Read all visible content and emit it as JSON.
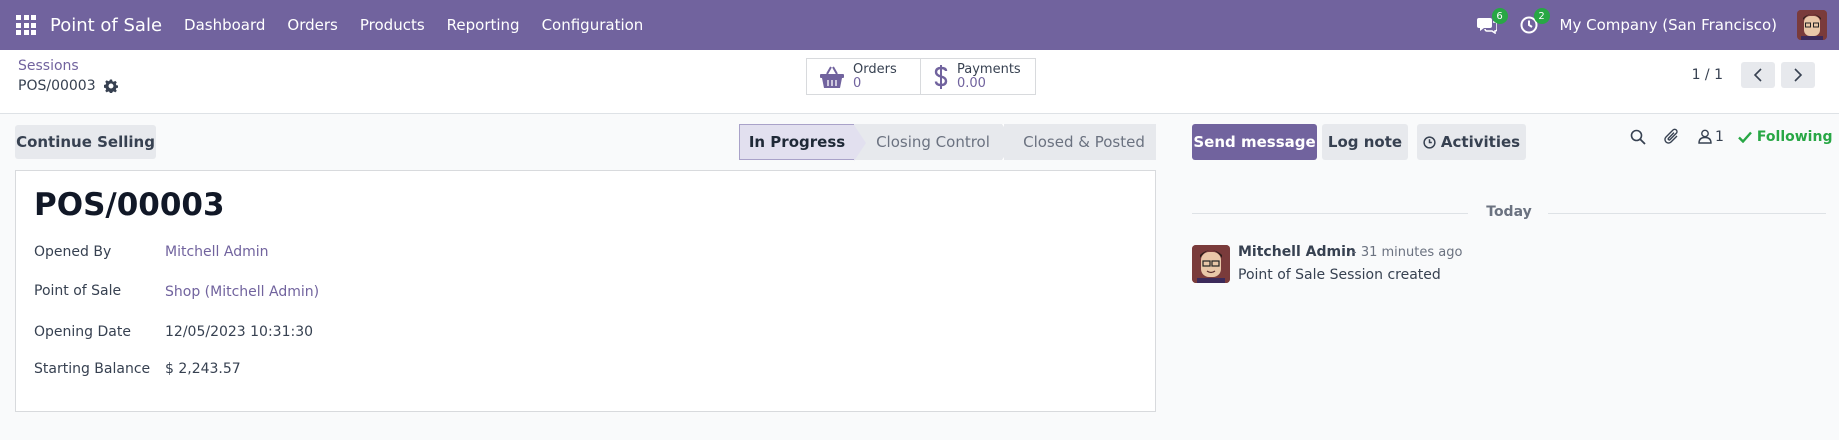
{
  "navbar": {
    "app_name": "Point of Sale",
    "menu": [
      "Dashboard",
      "Orders",
      "Products",
      "Reporting",
      "Configuration"
    ],
    "messages_badge": "6",
    "activities_badge": "2",
    "company": "My Company (San Francisco)"
  },
  "control_panel": {
    "breadcrumb": "Sessions",
    "record_name": "POS/00003",
    "orders_label": "Orders",
    "orders_value": "0",
    "payments_label": "Payments",
    "payments_value": "0.00",
    "pager_value": "1 / 1"
  },
  "actions": {
    "continue_selling": "Continue Selling"
  },
  "statusbar": {
    "stages": [
      "In Progress",
      "Closing Control",
      "Closed & Posted"
    ],
    "active_index": 0
  },
  "form": {
    "title": "POS/00003",
    "fields": [
      {
        "label": "Opened By",
        "value": "Mitchell Admin"
      },
      {
        "label": "Point of Sale",
        "value": "Shop (Mitchell Admin)"
      },
      {
        "label": "Opening Date",
        "value": "12/05/2023 10:31:30"
      },
      {
        "label": "Starting Balance",
        "value": "$ 2,243.57"
      }
    ]
  },
  "chatter": {
    "send_message": "Send message",
    "log_note": "Log note",
    "activities": "Activities",
    "followers_count": "1",
    "following": "Following",
    "date_separator": "Today",
    "message": {
      "author": "Mitchell Admin",
      "time": "- 31 minutes ago",
      "body": "Point of Sale Session created"
    }
  },
  "colors": {
    "brand": "#71639e",
    "badge": "#28a745",
    "following": "#28a745"
  }
}
